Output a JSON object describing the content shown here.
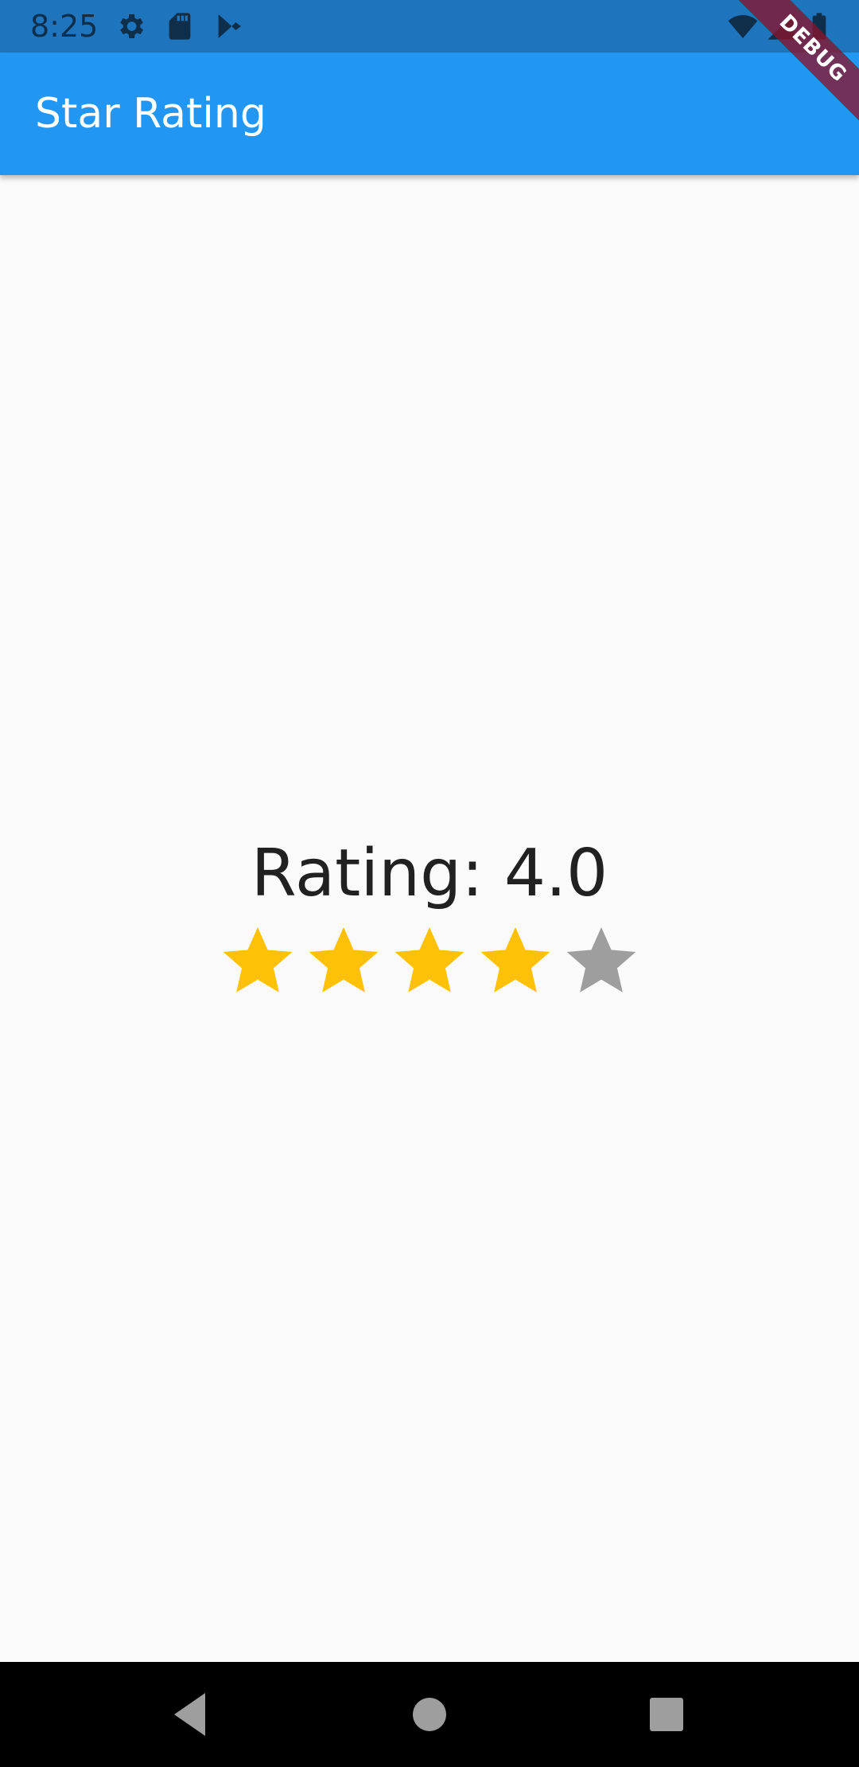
{
  "status_bar": {
    "time": "8:25",
    "left_icons": [
      "gear-icon",
      "sd-card-icon",
      "play-store-icon"
    ],
    "right_icons": [
      "wifi-icon",
      "signal-icon",
      "battery-icon"
    ],
    "background": "#1e74bd"
  },
  "debug_banner": {
    "label": "DEBUG"
  },
  "app_bar": {
    "title": "Star Rating",
    "background": "#2196f3"
  },
  "rating": {
    "label": "Rating: 4.0",
    "value": 4.0,
    "max": 5,
    "filled_color": "#ffc107",
    "empty_color": "#9e9e9e"
  },
  "nav_bar": {
    "buttons": [
      "back-icon",
      "home-icon",
      "recents-icon"
    ]
  }
}
